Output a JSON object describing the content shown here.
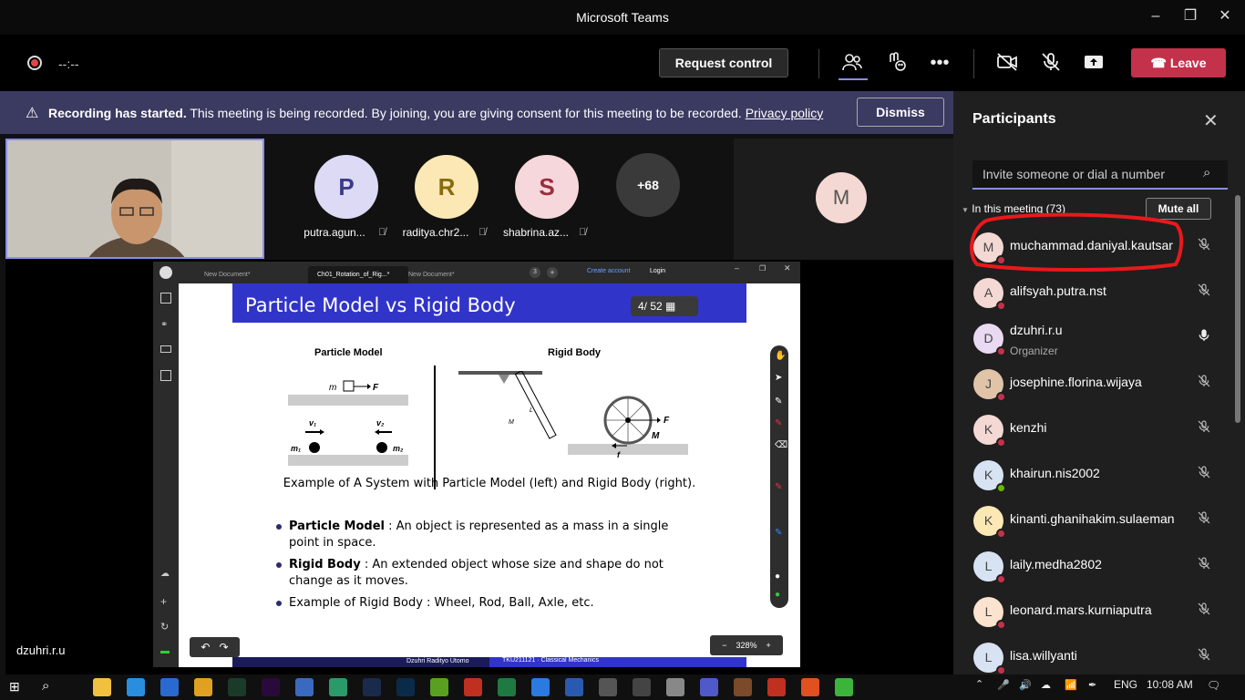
{
  "window": {
    "title": "Microsoft Teams",
    "min_icon": "minimize-icon",
    "max_icon": "maximize-icon",
    "close_icon": "close-icon"
  },
  "topbar": {
    "timer": "--:--",
    "request_control": "Request control",
    "leave": "Leave",
    "icons": [
      "participants-icon",
      "reactions-icon",
      "more-icon",
      "camera-off-icon",
      "mic-off-icon",
      "share-icon"
    ]
  },
  "banner": {
    "bold": "Recording has started.",
    "text": "This meeting is being recorded. By joining, you are giving consent for this meeting to be recorded.",
    "link": "Privacy policy",
    "dismiss": "Dismiss"
  },
  "stage": {
    "tiles": [
      {
        "initial": "P",
        "name": "putra.agun...",
        "color": "#dcdaf5",
        "fg": "#3b3a8a"
      },
      {
        "initial": "R",
        "name": "raditya.chr2...",
        "color": "#fbe8b5",
        "fg": "#8a6a10"
      },
      {
        "initial": "S",
        "name": "shabrina.az...",
        "color": "#f6d7dc",
        "fg": "#9a2e3e"
      }
    ],
    "more": "+68",
    "m_tile": "M",
    "presenter": "dzuhri.r.u"
  },
  "browser": {
    "tabs": [
      "New Document*",
      "Ch01_Rotation_of_Rig...*",
      "New Document*"
    ],
    "tab_count": "3",
    "create_account": "Create account",
    "login": "Login"
  },
  "slide": {
    "title": "Particle Model vs Rigid Body",
    "pager": "4/ 52",
    "particle_label": "Particle Model",
    "rigid_label": "Rigid Body",
    "caption": "Example of A System with Particle Model (left) and Rigid Body (right).",
    "bullets": [
      {
        "term": "Particle Model",
        "text": ": An object is represented as a mass in a single point in space."
      },
      {
        "term": "Rigid Body",
        "text": ": An extended object whose size and shape do not change as it moves."
      },
      {
        "term": "",
        "text": "Example of Rigid Body : Wheel, Rod, Ball, Axle, etc."
      }
    ],
    "zoom": "328%",
    "footer_left": "Dzuhri Radityo Utomo",
    "footer_mid": "TKU211121 · Classical Mechanics",
    "diagram": {
      "m": "m",
      "F": "F",
      "v1": "v1",
      "v2": "v2",
      "m1": "m1",
      "m2": "m2",
      "L": "L",
      "M": "M",
      "f": "f"
    }
  },
  "panel": {
    "title": "Participants",
    "invite_placeholder": "Invite someone or dial a number",
    "section": "In this meeting (73)",
    "mute_all": "Mute all",
    "participants": [
      {
        "initial": "M",
        "name": "muchammad.daniyal.kautsar",
        "role": "",
        "av": "#f3d8d3",
        "status": "#c4314b",
        "mic": "mic-off-icon"
      },
      {
        "initial": "A",
        "name": "alifsyah.putra.nst",
        "role": "",
        "av": "#f3d8d3",
        "status": "#c4314b",
        "mic": "mic-off-icon"
      },
      {
        "initial": "D",
        "name": "dzuhri.r.u",
        "role": "Organizer",
        "av": "#ead9f3",
        "status": "#c4314b",
        "mic": "mic-on-icon"
      },
      {
        "initial": "J",
        "name": "josephine.florina.wijaya",
        "role": "",
        "av": "#e0c4a8",
        "status": "#c4314b",
        "mic": "mic-off-icon"
      },
      {
        "initial": "K",
        "name": "kenzhi",
        "role": "",
        "av": "#f3d8d3",
        "status": "#c4314b",
        "mic": "mic-off-icon"
      },
      {
        "initial": "K",
        "name": "khairun.nis2002",
        "role": "",
        "av": "#d7e3f3",
        "status": "#6bb700",
        "mic": "mic-off-icon"
      },
      {
        "initial": "K",
        "name": "kinanti.ghanihakim.sulaeman",
        "role": "",
        "av": "#fbe8b5",
        "status": "#c4314b",
        "mic": "mic-off-icon"
      },
      {
        "initial": "L",
        "name": "laily.medha2802",
        "role": "",
        "av": "#d7e3f3",
        "status": "#c4314b",
        "mic": "mic-off-icon"
      },
      {
        "initial": "L",
        "name": "leonard.mars.kurniaputra",
        "role": "",
        "av": "#fbe3cf",
        "status": "#c4314b",
        "mic": "mic-off-icon"
      },
      {
        "initial": "L",
        "name": "lisa.willyanti",
        "role": "",
        "av": "#d7e3f3",
        "status": "#c4314b",
        "mic": "mic-off-icon"
      }
    ]
  },
  "taskbar": {
    "apps": [
      "file-explorer-icon",
      "edge-icon",
      "store-icon",
      "chrome-icon",
      "audition-icon",
      "premiere-icon",
      "notes-icon",
      "app-icon",
      "lightroom-icon",
      "photoshop-icon",
      "utorrent-icon",
      "app-icon",
      "excel-icon",
      "ie-icon",
      "word-icon",
      "app-icon",
      "obs-icon",
      "app-icon",
      "teams-icon",
      "app-icon",
      "app-icon",
      "app-icon",
      "line-icon"
    ],
    "lang": "ENG",
    "time": "10:08 AM"
  }
}
